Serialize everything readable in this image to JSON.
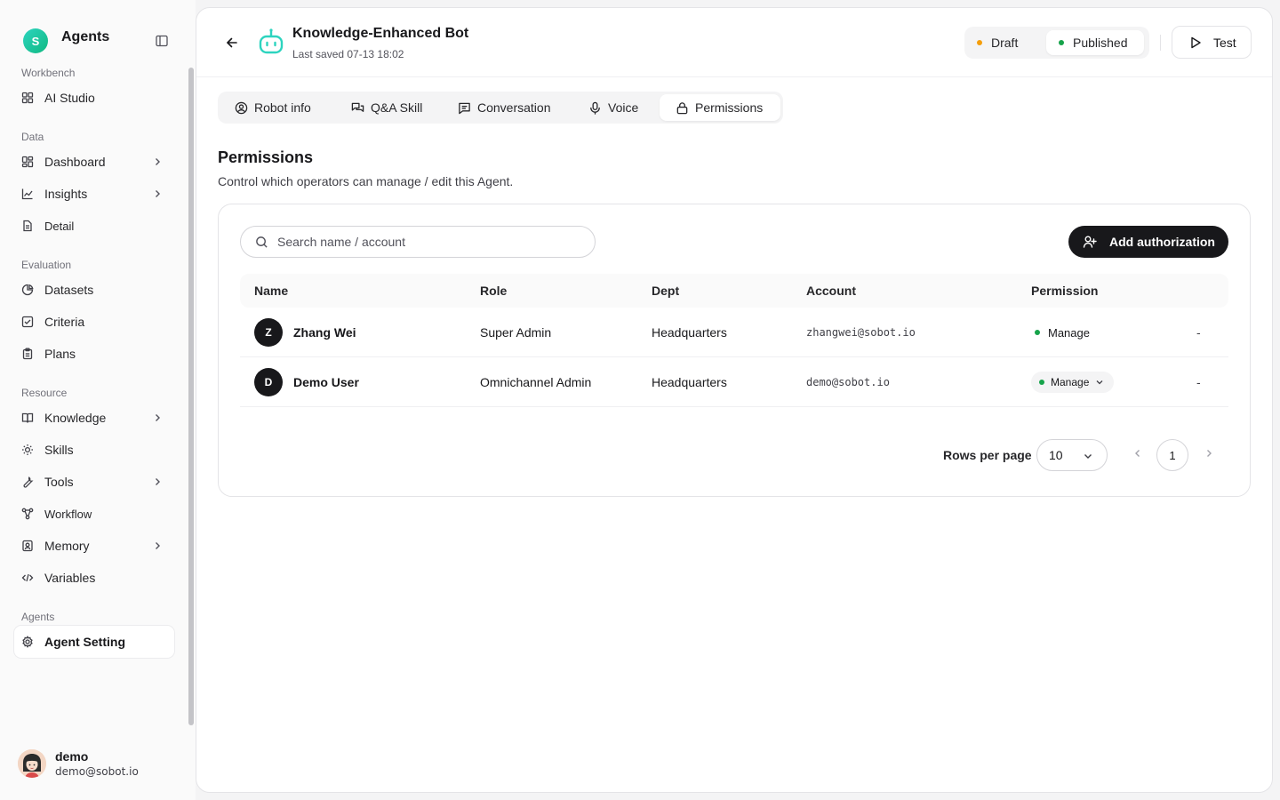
{
  "app": {
    "brand_initial": "S",
    "brand_name": "Agents"
  },
  "sidebar": {
    "sections": {
      "workbench": "Workbench",
      "data": "Data",
      "evaluation": "Evaluation",
      "resource": "Resource",
      "agents": "Agents"
    },
    "items": {
      "ai_studio": "AI Studio",
      "dashboard": "Dashboard",
      "insights": "Insights",
      "detail": "Detail",
      "datasets": "Datasets",
      "criteria": "Criteria",
      "plans": "Plans",
      "knowledge": "Knowledge",
      "skills": "Skills",
      "tools": "Tools",
      "workflow": "Workflow",
      "memory": "Memory",
      "variables": "Variables",
      "agent_setting": "Agent Setting"
    },
    "user": {
      "name": "demo",
      "email": "demo@sobot.io"
    }
  },
  "header": {
    "title": "Knowledge-Enhanced Bot",
    "last_saved": "Last saved 07-13 18:02",
    "status": {
      "draft": "Draft",
      "published": "Published",
      "selected": "Published"
    },
    "test_label": "Test"
  },
  "tabs": {
    "robot_info": "Robot info",
    "qa_skill": "Q&A Skill",
    "conversation": "Conversation",
    "voice": "Voice",
    "permissions": "Permissions",
    "active": "Permissions"
  },
  "permissions": {
    "title": "Permissions",
    "description": "Control which operators can manage / edit this Agent.",
    "search_placeholder": "Search name / account",
    "search_value": "",
    "add_label": "Add authorization",
    "columns": {
      "name": "Name",
      "role": "Role",
      "dept": "Dept",
      "account": "Account",
      "permission": "Permission"
    },
    "rows": [
      {
        "initial": "Z",
        "name": "Zhang Wei",
        "role": "Super Admin",
        "dept": "Headquarters",
        "account": "zhangwei@sobot.io",
        "permission": "Manage",
        "action": "-"
      },
      {
        "initial": "D",
        "name": "Demo User",
        "role": "Omnichannel Admin",
        "dept": "Headquarters",
        "account": "demo@sobot.io",
        "permission": "Manage",
        "action": "-"
      }
    ],
    "pagination": {
      "rows_per_page_label": "Rows per page",
      "rows_per_page": "10",
      "current_page": "1"
    }
  },
  "colors": {
    "brand": "#14b8a6",
    "draft_dot": "#f59e0b",
    "published_dot": "#16a34a",
    "primary_button": "#18181b"
  },
  "icons": {
    "back": "arrow-left-icon",
    "bot": "robot-icon",
    "test": "play-icon",
    "search": "search-icon",
    "add": "user-plus-icon"
  }
}
